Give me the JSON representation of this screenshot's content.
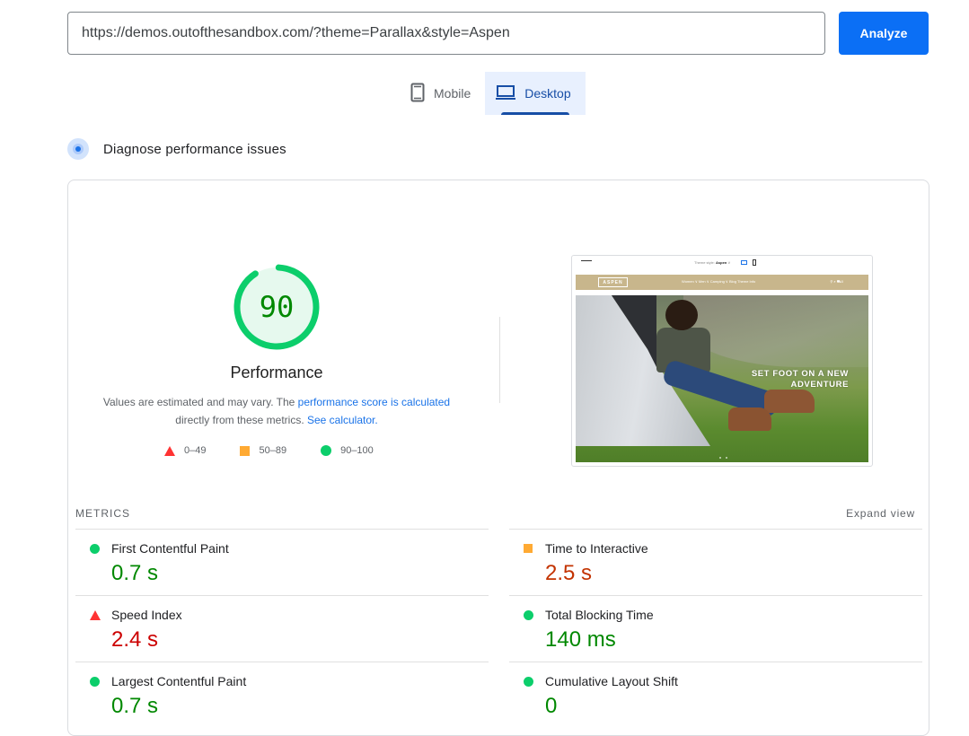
{
  "search": {
    "url_value": "https://demos.outofthesandbox.com/?theme=Parallax&style=Aspen",
    "analyze_label": "Analyze"
  },
  "tabs": [
    {
      "label": "Mobile",
      "icon": "phone-icon",
      "active": false
    },
    {
      "label": "Desktop",
      "icon": "laptop-icon",
      "active": true
    }
  ],
  "diagnose": {
    "title": "Diagnose performance issues",
    "icon": "lighthouse-radar-icon"
  },
  "performance": {
    "score": "90",
    "score_fraction": 0.9,
    "title": "Performance",
    "desc_prefix": "Values are estimated and may vary. The ",
    "desc_link1": "performance score is calculated",
    "desc_middle": " directly from these metrics. ",
    "desc_link2": "See calculator.",
    "legend": [
      {
        "shape": "triangle",
        "range": "0–49",
        "color": "#ff3333"
      },
      {
        "shape": "square",
        "range": "50–89",
        "color": "#ffaa33"
      },
      {
        "shape": "circle",
        "range": "90–100",
        "color": "#0cce6b"
      }
    ]
  },
  "screenshot": {
    "theme_style_label": "Theme style:",
    "theme_style_value": "Aspen",
    "brand": "ASPEN",
    "menu": "Women ∨   Men ∨   Camping ∨   Blog   Theme Info",
    "nav_icons": "⚲  ⌕  ⛟0",
    "hero_line1": "SET FOOT ON A NEW",
    "hero_line2": "ADVENTURE"
  },
  "metrics": {
    "heading": "METRICS",
    "expand_label": "Expand view",
    "left": [
      {
        "name": "First Contentful Paint",
        "value": "0.7 s",
        "rating": "pass"
      },
      {
        "name": "Speed Index",
        "value": "2.4 s",
        "rating": "fail"
      },
      {
        "name": "Largest Contentful Paint",
        "value": "0.7 s",
        "rating": "pass"
      }
    ],
    "right": [
      {
        "name": "Time to Interactive",
        "value": "2.5 s",
        "rating": "average"
      },
      {
        "name": "Total Blocking Time",
        "value": "140 ms",
        "rating": "pass"
      },
      {
        "name": "Cumulative Layout Shift",
        "value": "0",
        "rating": "pass"
      }
    ]
  },
  "colors": {
    "accent": "#1a73e8",
    "pass": "#0cce6b",
    "average": "#ffaa33",
    "fail": "#ff3333",
    "pass_text": "#008800",
    "average_text": "#c33300",
    "fail_text": "#cc0000"
  }
}
